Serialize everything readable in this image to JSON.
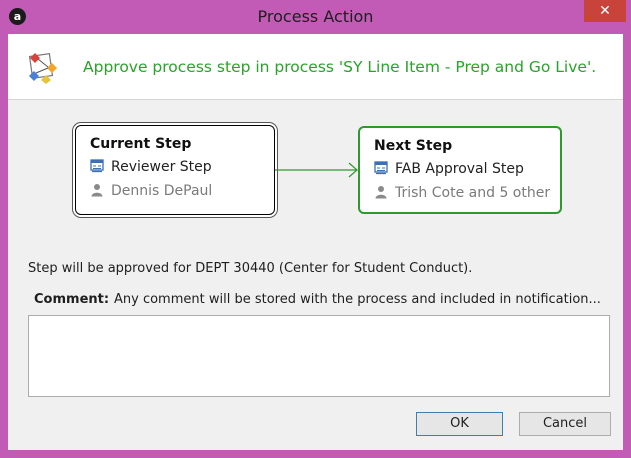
{
  "window": {
    "title": "Process Action",
    "close_glyph": "✕",
    "app_icon_letter": "a"
  },
  "header": {
    "text": "Approve process step in process 'SY Line Item - Prep and Go Live'."
  },
  "current_step": {
    "heading": "Current Step",
    "step_name": "Reviewer Step",
    "assignee": "Dennis DePaul"
  },
  "next_step": {
    "heading": "Next Step",
    "step_name": "FAB Approval Step",
    "assignee": "Trish Cote and 5 other"
  },
  "approval_note": "Step will be approved for DEPT 30440 (Center for Student Conduct).",
  "comment": {
    "label": "Comment:",
    "hint": "Any comment will be stored with the process and included in notification...",
    "value": ""
  },
  "buttons": {
    "ok": "OK",
    "cancel": "Cancel"
  },
  "colors": {
    "frame": "#c25bb6",
    "accent_green": "#29a329",
    "close_red": "#c8443a"
  }
}
